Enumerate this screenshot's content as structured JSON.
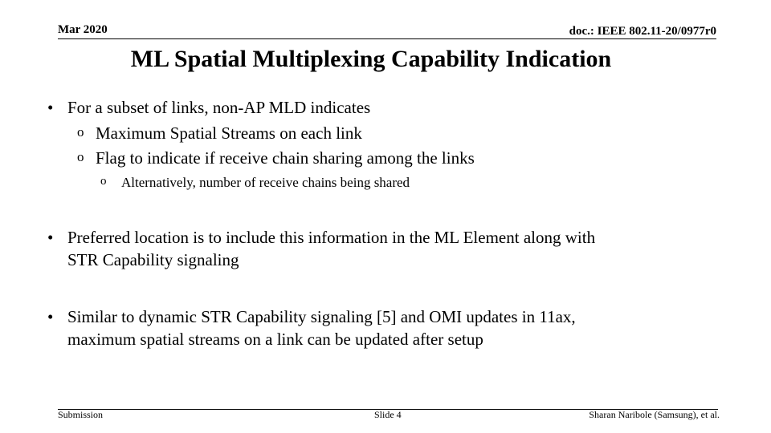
{
  "header": {
    "date": "Mar 2020",
    "doc_id": "doc.: IEEE 802.11-20/0977r0"
  },
  "title": "ML Spatial Multiplexing Capability Indication",
  "bullets": [
    {
      "text": "For a subset of links, non-AP MLD indicates",
      "sub": [
        {
          "text": "Maximum Spatial Streams on each link"
        },
        {
          "text": "Flag to indicate if receive chain sharing among the links",
          "sub": [
            {
              "text": "Alternatively, number of receive chains being shared"
            }
          ]
        }
      ]
    },
    {
      "line1": "Preferred location is to include this information in the ML Element along with",
      "line2": "STR Capability signaling"
    },
    {
      "line1": "Similar to dynamic STR Capability signaling [5] and OMI updates in 11ax,",
      "line2": "maximum spatial streams on a link can be updated after setup"
    }
  ],
  "markers": {
    "bullet": "•",
    "sub": "o"
  },
  "footer": {
    "left": "Submission",
    "center": "Slide 4",
    "right": "Sharan Naribole (Samsung), et al."
  }
}
